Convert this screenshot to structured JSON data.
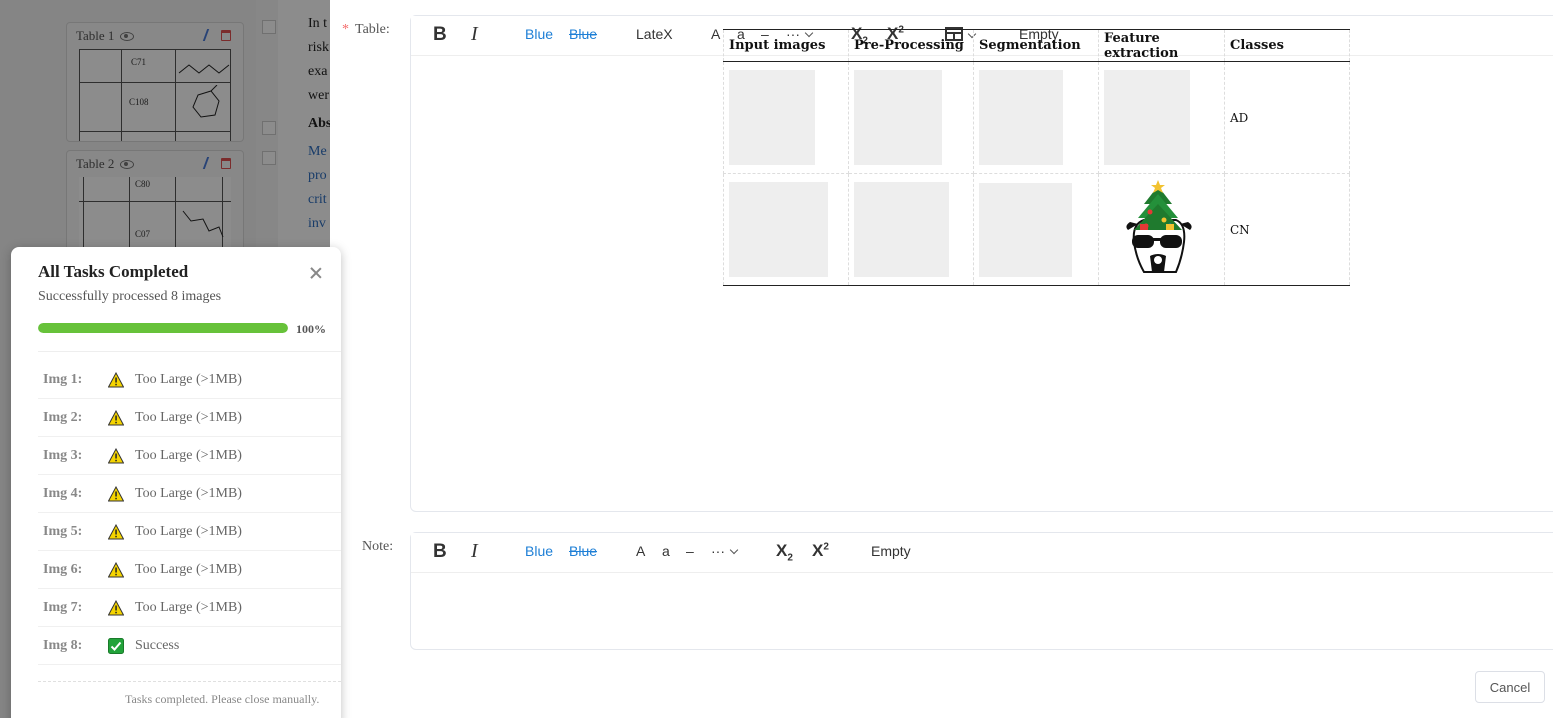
{
  "background": {
    "cards": [
      {
        "title": "Table 1",
        "cells": [
          "C71",
          "C108"
        ]
      },
      {
        "title": "Table 2",
        "cells": [
          "C80",
          "C07"
        ]
      }
    ],
    "text_lines": [
      "In t",
      "risk",
      "exa",
      "wer"
    ],
    "abstract_heading": "Abs",
    "blue_lines": [
      "Me",
      "pro",
      "crit",
      "inv"
    ]
  },
  "task_panel": {
    "title": "All Tasks Completed",
    "subtitle": "Successfully processed 8 images",
    "progress": 100,
    "progress_label": "100%",
    "items": [
      {
        "label": "Img 1:",
        "status": "warning",
        "text": "Too Large (>1MB)"
      },
      {
        "label": "Img 2:",
        "status": "warning",
        "text": "Too Large (>1MB)"
      },
      {
        "label": "Img 3:",
        "status": "warning",
        "text": "Too Large (>1MB)"
      },
      {
        "label": "Img 4:",
        "status": "warning",
        "text": "Too Large (>1MB)"
      },
      {
        "label": "Img 5:",
        "status": "warning",
        "text": "Too Large (>1MB)"
      },
      {
        "label": "Img 6:",
        "status": "warning",
        "text": "Too Large (>1MB)"
      },
      {
        "label": "Img 7:",
        "status": "warning",
        "text": "Too Large (>1MB)"
      },
      {
        "label": "Img 8:",
        "status": "success",
        "text": "Success"
      }
    ],
    "footer": "Tasks completed. Please close manually.",
    "colors": {
      "progress": "#67c23a",
      "warning": "#f5d400",
      "success": "#22a33a"
    }
  },
  "dialog": {
    "table_field": {
      "label": "Table:",
      "required": true,
      "toolbar": {
        "bold": "B",
        "italic": "I",
        "blue": "Blue",
        "blue_strike": "Blue",
        "latex": "LateX",
        "font_upper": "A",
        "font_lower": "a",
        "dash": "–",
        "more": "···",
        "subscript": "X",
        "subscript_mark": "2",
        "superscript": "X",
        "superscript_mark": "2",
        "table_icon": "table-icon",
        "empty": "Empty"
      }
    },
    "table": {
      "headers": [
        "Input images",
        "Pre-Processing",
        "Segmentation",
        "Feature extraction",
        "Classes"
      ],
      "rows": [
        {
          "class": "AD"
        },
        {
          "class": "CN"
        }
      ]
    },
    "note_field": {
      "label": "Note:",
      "toolbar": {
        "bold": "B",
        "italic": "I",
        "blue": "Blue",
        "blue_strike": "Blue",
        "font_upper": "A",
        "font_lower": "a",
        "dash": "–",
        "more": "···",
        "subscript": "X",
        "subscript_mark": "2",
        "superscript": "X",
        "superscript_mark": "2",
        "empty": "Empty"
      }
    },
    "cancel_label": "Cancel"
  }
}
